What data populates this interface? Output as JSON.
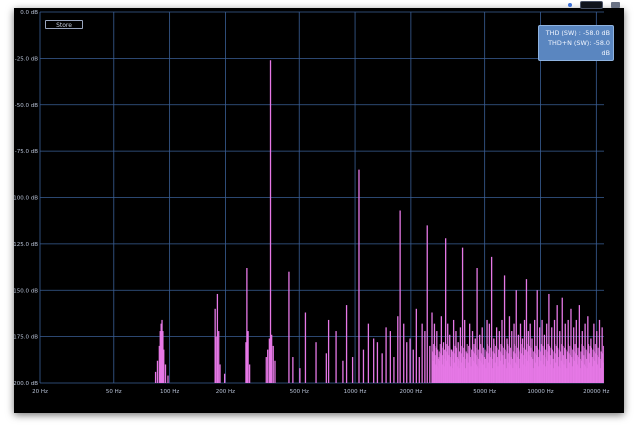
{
  "store_button": "Store",
  "readouts": {
    "thd": "THD (SW) : -58.0 dB",
    "thdn": "THD+N (SW): -58.0 dB"
  },
  "colors": {
    "background": "#000000",
    "grid": "#3a5f96",
    "trace": "#e678e6"
  },
  "chart_data": {
    "type": "bar",
    "x_scale": "log",
    "xlim": [
      20,
      22000
    ],
    "ylim": [
      -200,
      0
    ],
    "x_ticks": [
      {
        "value": 20,
        "label": "20 Hz"
      },
      {
        "value": 50,
        "label": "50 Hz"
      },
      {
        "value": 100,
        "label": "100 Hz"
      },
      {
        "value": 200,
        "label": "200 Hz"
      },
      {
        "value": 500,
        "label": "500 Hz"
      },
      {
        "value": 1000,
        "label": "1000 Hz"
      },
      {
        "value": 2000,
        "label": "2000 Hz"
      },
      {
        "value": 5000,
        "label": "5000 Hz"
      },
      {
        "value": 10000,
        "label": "10000 Hz"
      },
      {
        "value": 20000,
        "label": "20000 Hz"
      }
    ],
    "y_ticks": [
      {
        "value": 0,
        "label": "0.0 dB"
      },
      {
        "value": -25,
        "label": "-25.0 dB"
      },
      {
        "value": -50,
        "label": "-50.0 dB"
      },
      {
        "value": -75,
        "label": "-75.0 dB"
      },
      {
        "value": -100,
        "label": "-100.0 dB"
      },
      {
        "value": -125,
        "label": "-125.0 dB"
      },
      {
        "value": -150,
        "label": "-150.0 dB"
      },
      {
        "value": -175,
        "label": "-175.0 dB"
      },
      {
        "value": -200,
        "label": "-200.0 dB"
      }
    ],
    "grid": true,
    "peaks": [
      {
        "x": 84,
        "y": -194
      },
      {
        "x": 86,
        "y": -188
      },
      {
        "x": 88,
        "y": -180
      },
      {
        "x": 89,
        "y": -172
      },
      {
        "x": 90,
        "y": -168
      },
      {
        "x": 91,
        "y": -166
      },
      {
        "x": 92,
        "y": -172
      },
      {
        "x": 93,
        "y": -182
      },
      {
        "x": 95,
        "y": -190
      },
      {
        "x": 98,
        "y": -196
      },
      {
        "x": 176,
        "y": -160
      },
      {
        "x": 178,
        "y": -175
      },
      {
        "x": 181,
        "y": -152
      },
      {
        "x": 184,
        "y": -172
      },
      {
        "x": 187,
        "y": -190
      },
      {
        "x": 198,
        "y": -195
      },
      {
        "x": 258,
        "y": -178
      },
      {
        "x": 261,
        "y": -138
      },
      {
        "x": 265,
        "y": -172
      },
      {
        "x": 270,
        "y": -190
      },
      {
        "x": 332,
        "y": -186
      },
      {
        "x": 338,
        "y": -182
      },
      {
        "x": 345,
        "y": -176
      },
      {
        "x": 350,
        "y": -26
      },
      {
        "x": 355,
        "y": -174
      },
      {
        "x": 362,
        "y": -180
      },
      {
        "x": 370,
        "y": -188
      },
      {
        "x": 440,
        "y": -140
      },
      {
        "x": 462,
        "y": -186
      },
      {
        "x": 504,
        "y": -192
      },
      {
        "x": 540,
        "y": -162
      },
      {
        "x": 616,
        "y": -178
      },
      {
        "x": 700,
        "y": -184
      },
      {
        "x": 720,
        "y": -166
      },
      {
        "x": 790,
        "y": -172
      },
      {
        "x": 860,
        "y": -188
      },
      {
        "x": 900,
        "y": -158
      },
      {
        "x": 970,
        "y": -186
      },
      {
        "x": 1050,
        "y": -85
      },
      {
        "x": 1110,
        "y": -182
      },
      {
        "x": 1180,
        "y": -168
      },
      {
        "x": 1260,
        "y": -176
      },
      {
        "x": 1320,
        "y": -178
      },
      {
        "x": 1400,
        "y": -184
      },
      {
        "x": 1470,
        "y": -170
      },
      {
        "x": 1550,
        "y": -172
      },
      {
        "x": 1620,
        "y": -186
      },
      {
        "x": 1700,
        "y": -164
      },
      {
        "x": 1750,
        "y": -107
      },
      {
        "x": 1830,
        "y": -168
      },
      {
        "x": 1900,
        "y": -178
      },
      {
        "x": 1980,
        "y": -176
      },
      {
        "x": 2060,
        "y": -182
      },
      {
        "x": 2140,
        "y": -160
      },
      {
        "x": 2220,
        "y": -186
      },
      {
        "x": 2300,
        "y": -168
      },
      {
        "x": 2380,
        "y": -172
      },
      {
        "x": 2450,
        "y": -115
      },
      {
        "x": 2530,
        "y": -180
      },
      {
        "x": 2600,
        "y": -162
      },
      {
        "x": 2680,
        "y": -168
      },
      {
        "x": 2760,
        "y": -172
      },
      {
        "x": 2840,
        "y": -186
      },
      {
        "x": 2920,
        "y": -164
      },
      {
        "x": 3000,
        "y": -178
      },
      {
        "x": 3080,
        "y": -122
      },
      {
        "x": 3160,
        "y": -168
      },
      {
        "x": 3240,
        "y": -174
      },
      {
        "x": 3320,
        "y": -182
      },
      {
        "x": 3400,
        "y": -166
      },
      {
        "x": 3500,
        "y": -172
      },
      {
        "x": 3600,
        "y": -178
      },
      {
        "x": 3700,
        "y": -170
      },
      {
        "x": 3800,
        "y": -127
      },
      {
        "x": 3900,
        "y": -166
      },
      {
        "x": 4000,
        "y": -184
      },
      {
        "x": 4150,
        "y": -168
      },
      {
        "x": 4300,
        "y": -172
      },
      {
        "x": 4450,
        "y": -176
      },
      {
        "x": 4550,
        "y": -138
      },
      {
        "x": 4700,
        "y": -174
      },
      {
        "x": 4850,
        "y": -170
      },
      {
        "x": 5000,
        "y": -186
      },
      {
        "x": 5150,
        "y": -166
      },
      {
        "x": 5300,
        "y": -168
      },
      {
        "x": 5450,
        "y": -132
      },
      {
        "x": 5600,
        "y": -176
      },
      {
        "x": 5800,
        "y": -170
      },
      {
        "x": 6000,
        "y": -172
      },
      {
        "x": 6200,
        "y": -166
      },
      {
        "x": 6400,
        "y": -142
      },
      {
        "x": 6600,
        "y": -176
      },
      {
        "x": 6800,
        "y": -164
      },
      {
        "x": 7000,
        "y": -172
      },
      {
        "x": 7200,
        "y": -168
      },
      {
        "x": 7400,
        "y": -150
      },
      {
        "x": 7600,
        "y": -174
      },
      {
        "x": 7800,
        "y": -168
      },
      {
        "x": 8000,
        "y": -176
      },
      {
        "x": 8200,
        "y": -166
      },
      {
        "x": 8400,
        "y": -144
      },
      {
        "x": 8600,
        "y": -172
      },
      {
        "x": 8800,
        "y": -168
      },
      {
        "x": 9000,
        "y": -176
      },
      {
        "x": 9300,
        "y": -166
      },
      {
        "x": 9600,
        "y": -150
      },
      {
        "x": 9900,
        "y": -170
      },
      {
        "x": 10200,
        "y": -166
      },
      {
        "x": 10500,
        "y": -174
      },
      {
        "x": 10800,
        "y": -168
      },
      {
        "x": 11100,
        "y": -152
      },
      {
        "x": 11500,
        "y": -170
      },
      {
        "x": 11900,
        "y": -166
      },
      {
        "x": 12300,
        "y": -158
      },
      {
        "x": 12700,
        "y": -172
      },
      {
        "x": 13100,
        "y": -154
      },
      {
        "x": 13600,
        "y": -168
      },
      {
        "x": 14100,
        "y": -166
      },
      {
        "x": 14600,
        "y": -160
      },
      {
        "x": 15100,
        "y": -170
      },
      {
        "x": 15600,
        "y": -166
      },
      {
        "x": 16200,
        "y": -158
      },
      {
        "x": 16800,
        "y": -172
      },
      {
        "x": 17400,
        "y": -168
      },
      {
        "x": 18000,
        "y": -164
      },
      {
        "x": 18700,
        "y": -176
      },
      {
        "x": 19400,
        "y": -168
      },
      {
        "x": 20100,
        "y": -172
      },
      {
        "x": 20800,
        "y": -166
      },
      {
        "x": 21500,
        "y": -170
      }
    ]
  }
}
